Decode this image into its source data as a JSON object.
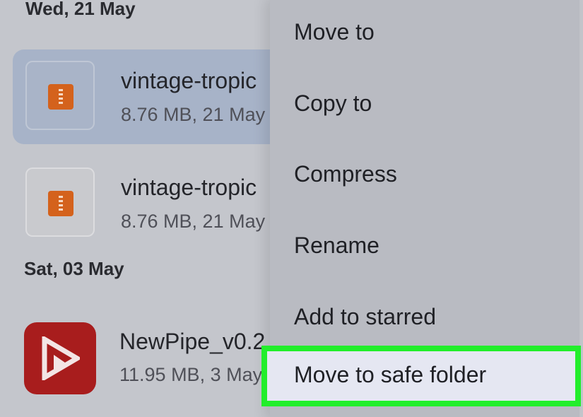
{
  "groups": [
    {
      "date": "Wed, 21 May",
      "files": [
        {
          "name": "vintage-tropic",
          "meta": "8.76 MB, 21 May",
          "icon": "zip-file-icon",
          "selected": true
        },
        {
          "name": "vintage-tropic",
          "meta": "8.76 MB, 21 May",
          "icon": "zip-file-icon",
          "selected": false
        }
      ]
    },
    {
      "date": "Sat, 03 May",
      "files": [
        {
          "name": "NewPipe_v0.2",
          "meta": "11.95 MB, 3 May",
          "icon": "newpipe-app-icon",
          "selected": false
        }
      ]
    }
  ],
  "context_menu": {
    "items": [
      {
        "label": "Move to"
      },
      {
        "label": "Copy to"
      },
      {
        "label": "Compress"
      },
      {
        "label": "Rename"
      },
      {
        "label": "Add to starred"
      },
      {
        "label": "Move to safe folder",
        "highlighted": true
      }
    ]
  },
  "colors": {
    "background": "#c4c6cc",
    "selected_row": "#a7b3c8",
    "zip_icon": "#d4621c",
    "app_icon": "#a81d1d",
    "menu_background": "#b9bbc2",
    "highlight_border": "#22ee2b"
  }
}
